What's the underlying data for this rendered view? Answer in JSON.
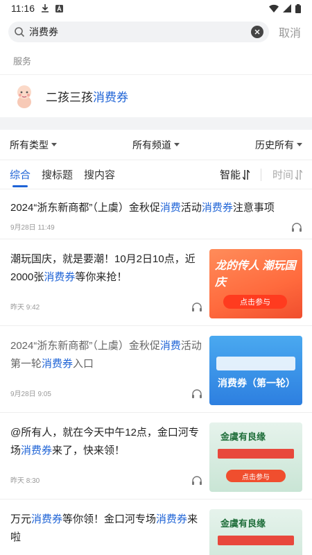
{
  "status_bar": {
    "time": "11:16",
    "icons": [
      "download-icon",
      "a-icon",
      "wifi-icon",
      "signal-icon",
      "battery-icon"
    ]
  },
  "search": {
    "value": "消费券",
    "placeholder": "",
    "cancel_label": "取消"
  },
  "services": {
    "section_label": "服务",
    "item": {
      "title_prefix": "二孩三孩",
      "title_highlight": "消费券",
      "icon": "baby-icon"
    }
  },
  "filters": [
    {
      "label": "所有类型"
    },
    {
      "label": "所有频道"
    },
    {
      "label": "历史所有"
    }
  ],
  "tabs": [
    {
      "label": "综合",
      "active": true
    },
    {
      "label": "搜标题",
      "active": false
    },
    {
      "label": "搜内容",
      "active": false
    }
  ],
  "sort": {
    "smart_label": "智能",
    "time_label": "时间"
  },
  "articles": [
    {
      "title_parts": [
        "2024“浙东新商都”（上虞）金秋促",
        "消费",
        "活动",
        "消费券",
        "注意事项"
      ],
      "date": "9月28日 11:49",
      "thumb": null
    },
    {
      "title_parts": [
        "潮玩国庆，就是要潮！10月2日10点，近2000张",
        "消费券",
        "等你来抢！",
        "",
        ""
      ],
      "date": "昨天 9:42",
      "thumb": {
        "style": "thumb1",
        "headline": "龙的传人 潮玩国庆",
        "button": "点击参与"
      }
    },
    {
      "title_parts": [
        "2024“浙东新商都”（上虞）金秋促",
        "消费",
        "活动第一轮",
        "消费券",
        "入口"
      ],
      "date": "9月28日 9:05",
      "thumb": {
        "style": "thumb2",
        "headline": "消费券（第一轮）",
        "button": ""
      }
    },
    {
      "title_parts": [
        "@所有人，就在今天中午12点，金口河专场",
        "消费券",
        "来了，快来领！",
        "",
        ""
      ],
      "date": "昨天 8:30",
      "thumb": {
        "style": "thumb3",
        "headline": "金虞有良缘",
        "button": "点击参与"
      }
    },
    {
      "title_parts": [
        "万元",
        "消费券",
        "等你领！金口河专场",
        "消费券",
        "来啦"
      ],
      "date": "",
      "thumb": {
        "style": "thumb3",
        "headline": "金虞有良缘",
        "button": ""
      }
    }
  ],
  "colors": {
    "accent": "#1e63d6",
    "muted": "#999999"
  }
}
